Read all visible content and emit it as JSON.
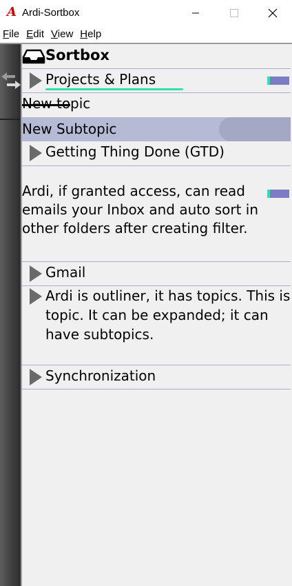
{
  "window": {
    "logo_glyph": "A",
    "title": "Ardi-Sortbox",
    "controls": {
      "minimize": "minimize-icon",
      "maximize": "maximize-icon",
      "close": "close-icon"
    }
  },
  "menu": {
    "items": [
      {
        "accel": "F",
        "rest": "ile"
      },
      {
        "accel": "E",
        "rest": "dit"
      },
      {
        "accel": "V",
        "rest": "iew"
      },
      {
        "accel": "H",
        "rest": "elp"
      }
    ]
  },
  "colors": {
    "highlight_row": "#b6bbd5",
    "accent_green": "#2ee3a8",
    "accent_purple": "#7c7cc4",
    "logo_red": "#d40000"
  },
  "outline": {
    "header": {
      "icon": "inbox-tray-icon",
      "title": "Sortbox"
    },
    "projects": {
      "label": "Projects & Plans"
    },
    "new_topic": {
      "label": "New topic"
    },
    "new_subtopic": {
      "label": "New Subtopic"
    },
    "gtd": {
      "label": "Getting Thing Done (GTD)"
    },
    "inbox_note": {
      "text": "Ardi, if granted access, can read emails your Inbox and auto sort in other folders after creating filter."
    },
    "gmail": {
      "label": "Gmail"
    },
    "outliner_note": {
      "text": "Ardi is outliner, it has topics. This is topic. It can be expanded; it can have subtopics."
    },
    "sync": {
      "label": "Synchronization"
    }
  },
  "sidebar": {
    "icon": "swap-arrows-icon"
  }
}
